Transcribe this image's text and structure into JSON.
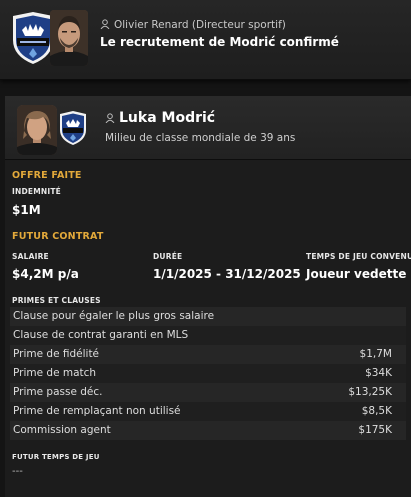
{
  "news": {
    "author": "Olivier Renard",
    "author_role": "(Directeur sportif)",
    "title": "Le recrutement de Modrić confirmé"
  },
  "player": {
    "name": "Luka Modrić",
    "description": "Milieu de classe mondiale de 39 ans"
  },
  "offer": {
    "section_title": "OFFRE FAITE",
    "fee_label": "INDEMNITÉ",
    "fee_value": "$1M"
  },
  "contract": {
    "section_title": "FUTUR CONTRAT",
    "salary_label": "SALAIRE",
    "salary_value": "$4,2M p/a",
    "duration_label": "DURÉE",
    "duration_value": "1/1/2025 - 31/12/2025",
    "playtime_label": "TEMPS DE JEU CONVENU",
    "playtime_value": "Joueur vedette",
    "clauses_label": "PRIMES ET CLAUSES",
    "clauses": [
      {
        "label": "Clause pour égaler le plus gros salaire",
        "value": ""
      },
      {
        "label": "Clause de contrat garanti en MLS",
        "value": ""
      },
      {
        "label": "Prime de fidélité",
        "value": "$1,7M"
      },
      {
        "label": "Prime de match",
        "value": "$34K"
      },
      {
        "label": "Prime passe déc.",
        "value": "$13,25K"
      },
      {
        "label": "Prime de remplaçant non utilisé",
        "value": "$8,5K"
      },
      {
        "label": "Commission agent",
        "value": "$175K"
      }
    ],
    "future_playtime_label": "FUTUR TEMPS DE JEU",
    "future_playtime_value": "---"
  },
  "colors": {
    "accent": "#e3a93a",
    "club_blue": "#1f3f86",
    "background": "#141414"
  },
  "icons": [
    "user-icon",
    "club-logo",
    "person-photo"
  ]
}
